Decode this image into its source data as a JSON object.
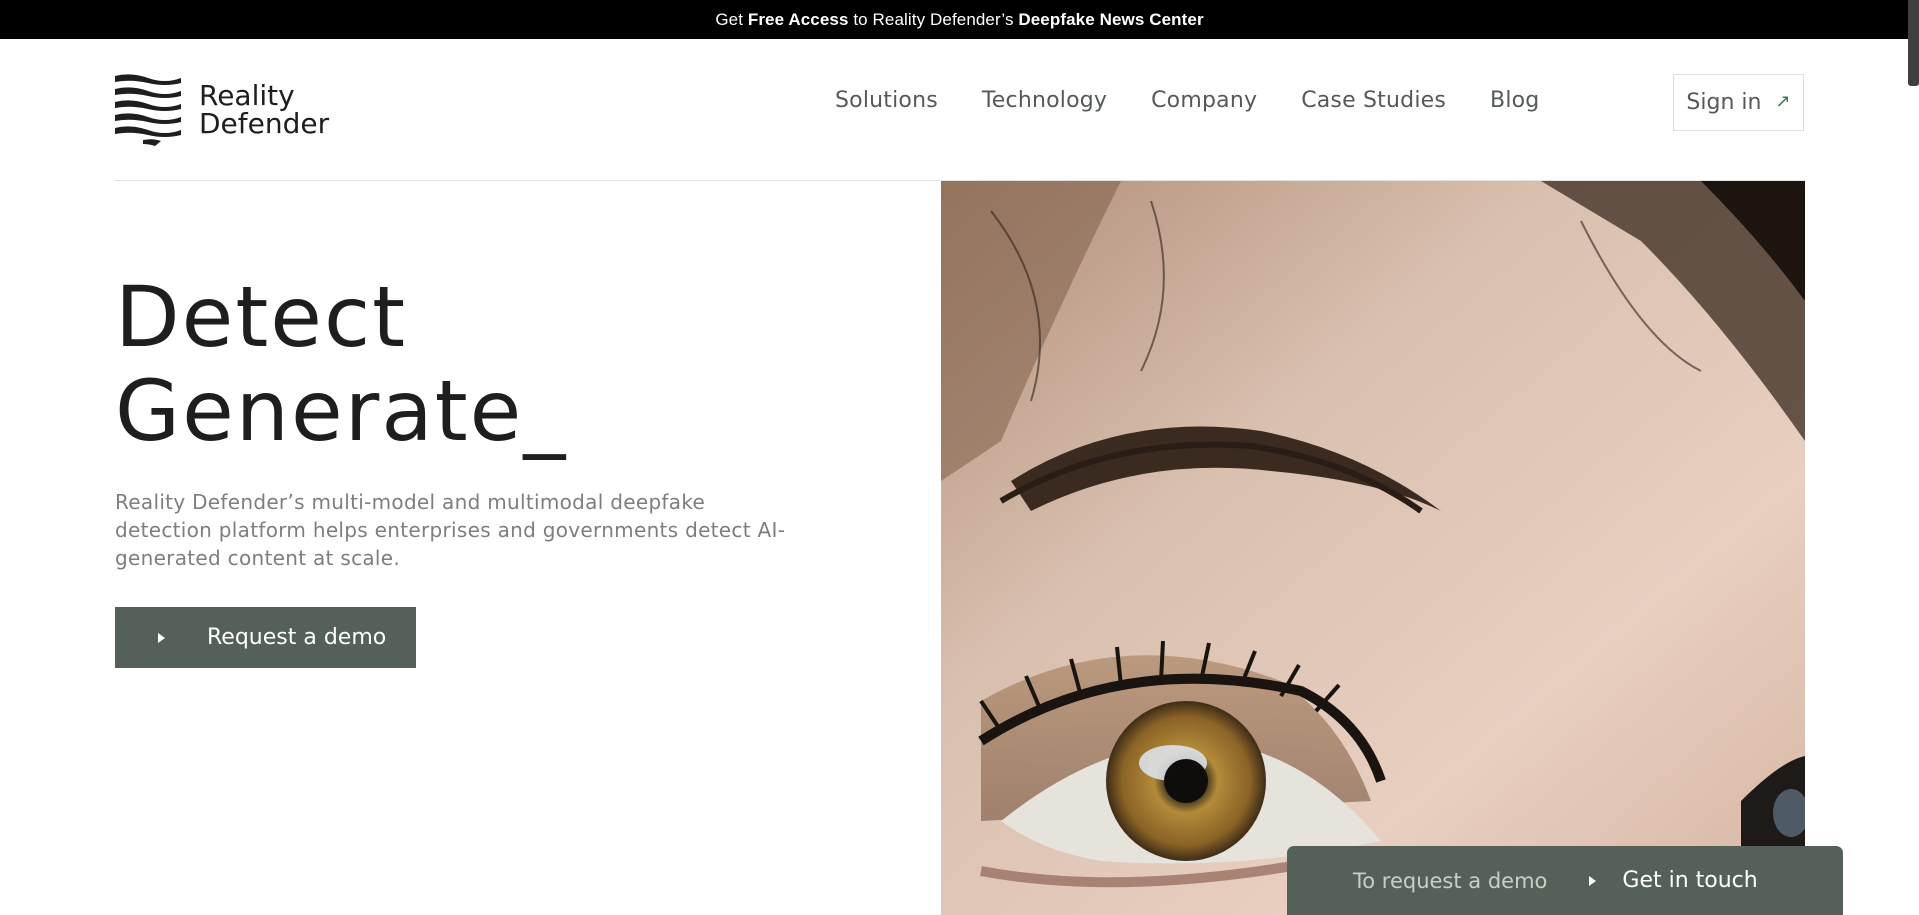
{
  "banner": {
    "prefix": "Get ",
    "bold1": "Free Access",
    "middle": " to Reality Defender’s ",
    "bold2": "Deepfake News Center"
  },
  "brand": {
    "line1": "Reality",
    "line2": "Defender",
    "logo_icon": "stripes-flag-logo"
  },
  "nav": {
    "items": [
      "Solutions",
      "Technology",
      "Company",
      "Case Studies",
      "Blog"
    ],
    "signin_label": "Sign in",
    "signin_icon": "arrow-up-right-icon"
  },
  "hero": {
    "headline_line1": "Detect",
    "headline_line2": "Generate_",
    "description": "Reality Defender’s multi-model and multimodal deepfake detection platform helps enterprises and governments detect AI-generated content at scale.",
    "cta_label": "Request a demo",
    "cta_icon": "play-triangle-icon"
  },
  "image": {
    "subject": "close-up-eye-photo"
  },
  "floating_bar": {
    "text": "To request a demo",
    "link_label": "Get in touch",
    "icon": "play-triangle-icon"
  },
  "colors": {
    "accent": "#556158",
    "banner_bg": "#000000",
    "text_muted": "#7c7f7d",
    "nav_text": "#555a57"
  }
}
